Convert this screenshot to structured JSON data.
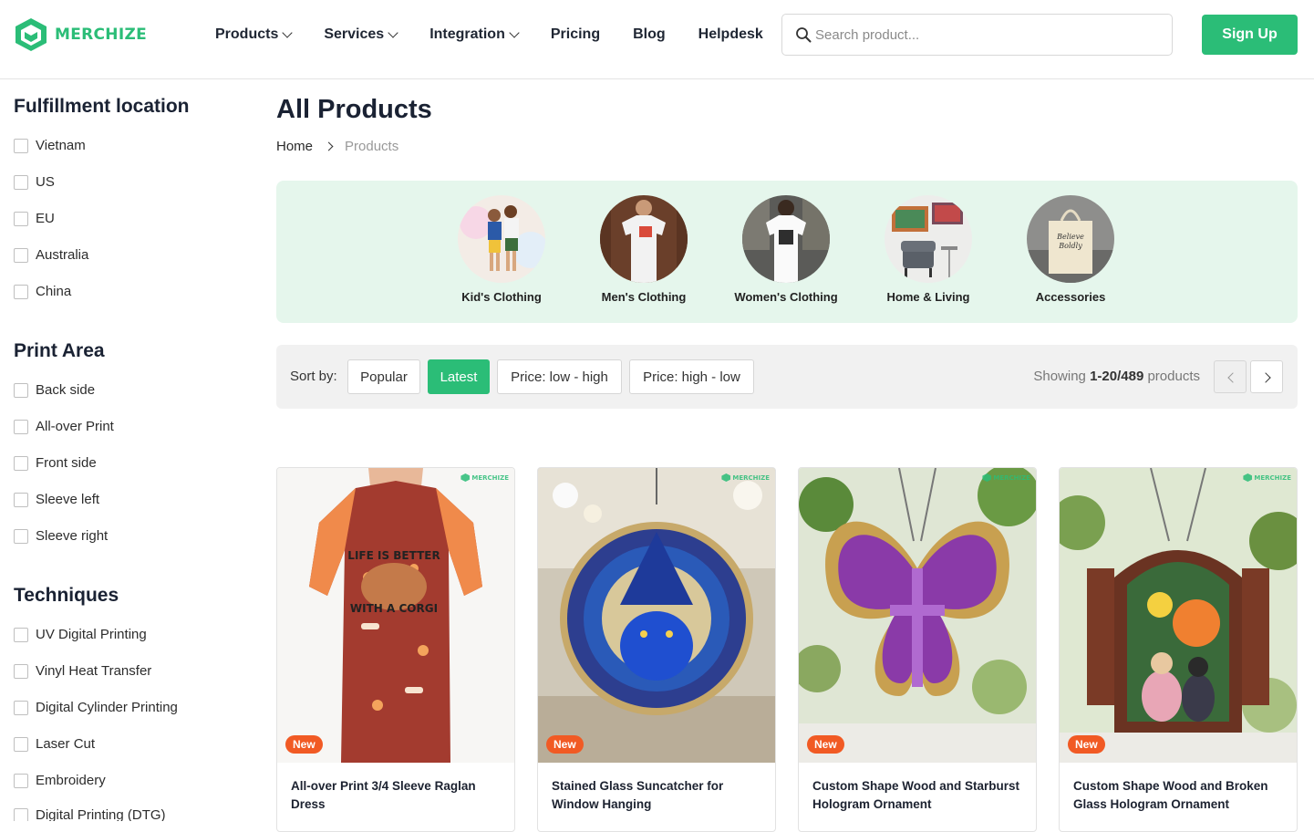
{
  "header": {
    "brand": "MERCHIZE",
    "nav": [
      {
        "label": "Products",
        "dropdown": true
      },
      {
        "label": "Services",
        "dropdown": true
      },
      {
        "label": "Integration",
        "dropdown": true
      },
      {
        "label": "Pricing",
        "dropdown": false
      },
      {
        "label": "Blog",
        "dropdown": false
      },
      {
        "label": "Helpdesk",
        "dropdown": false
      }
    ],
    "search_placeholder": "Search product...",
    "signup_label": "Sign Up"
  },
  "sidebar": {
    "fulfillment": {
      "title": "Fulfillment location",
      "options": [
        "Vietnam",
        "US",
        "EU",
        "Australia",
        "China"
      ]
    },
    "print_area": {
      "title": "Print Area",
      "options": [
        "Back side",
        "All-over Print",
        "Front side",
        "Sleeve left",
        "Sleeve right"
      ]
    },
    "techniques": {
      "title": "Techniques",
      "options": [
        "UV Digital Printing",
        "Vinyl Heat Transfer",
        "Digital Cylinder Printing",
        "Laser Cut",
        "Embroidery",
        "Digital Printing (DTG)"
      ]
    }
  },
  "main": {
    "title": "All Products",
    "breadcrumb": {
      "home": "Home",
      "current": "Products"
    },
    "categories": [
      {
        "label": "Kid's Clothing"
      },
      {
        "label": "Men's Clothing"
      },
      {
        "label": "Women's Clothing"
      },
      {
        "label": "Home & Living"
      },
      {
        "label": "Accessories"
      }
    ],
    "sort": {
      "label": "Sort by:",
      "options": [
        "Popular",
        "Latest",
        "Price: low - high",
        "Price: high - low"
      ],
      "active": "Latest"
    },
    "showing": {
      "prefix": "Showing ",
      "range": "1-20/489",
      "suffix": " products"
    },
    "products": [
      {
        "title": "All-over Print 3/4 Sleeve Raglan Dress",
        "badge": "New"
      },
      {
        "title": "Stained Glass Suncatcher for Window Hanging",
        "badge": "New"
      },
      {
        "title": "Custom Shape Wood and Starburst Hologram Ornament",
        "badge": "New"
      },
      {
        "title": "Custom Shape Wood and Broken Glass Hologram Ornament",
        "badge": "New"
      }
    ],
    "watermark": "MERCHIZE"
  },
  "colors": {
    "accent": "#2bbd77",
    "badge": "#f15a24",
    "category_bg": "#e5f6ec",
    "sortbar_bg": "#f1f1f1"
  }
}
